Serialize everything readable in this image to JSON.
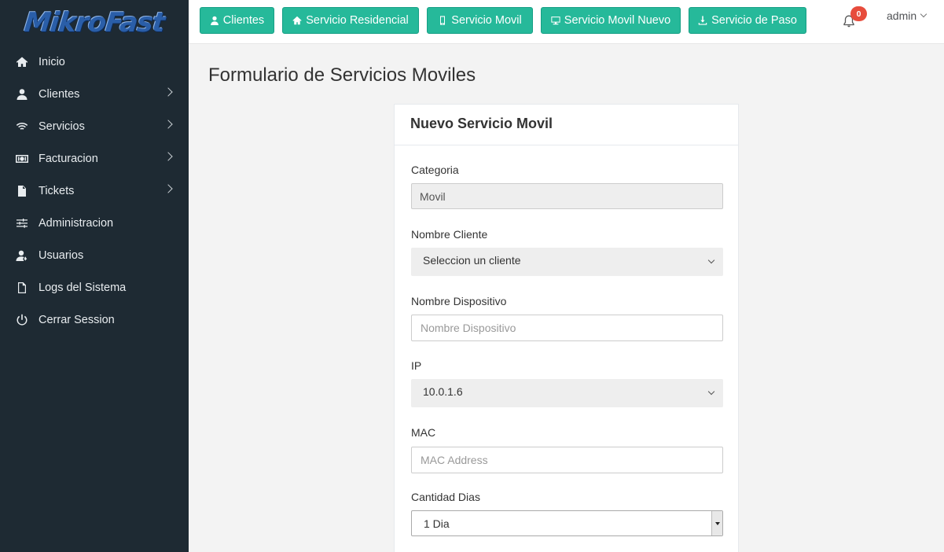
{
  "brand": {
    "logo_text": "MikroFast"
  },
  "sidebar": {
    "items": [
      {
        "label": "Inicio",
        "icon": "home-icon",
        "has_submenu": false
      },
      {
        "label": "Clientes",
        "icon": "user-icon",
        "has_submenu": true
      },
      {
        "label": "Servicios",
        "icon": "wifi-icon",
        "has_submenu": true
      },
      {
        "label": "Facturacion",
        "icon": "money-icon",
        "has_submenu": true
      },
      {
        "label": "Tickets",
        "icon": "file-icon",
        "has_submenu": true
      },
      {
        "label": "Administracion",
        "icon": "sliders-icon",
        "has_submenu": false
      },
      {
        "label": "Usuarios",
        "icon": "users-icon",
        "has_submenu": false
      },
      {
        "label": "Logs del Sistema",
        "icon": "file-outline-icon",
        "has_submenu": false
      },
      {
        "label": "Cerrar Session",
        "icon": "power-icon",
        "has_submenu": false
      }
    ]
  },
  "topbar": {
    "buttons": [
      {
        "label": "Clientes",
        "icon": "user-icon"
      },
      {
        "label": "Servicio Residencial",
        "icon": "home-icon"
      },
      {
        "label": "Servicio Movil",
        "icon": "mobile-icon"
      },
      {
        "label": "Servicio Movil Nuevo",
        "icon": "desktop-icon"
      },
      {
        "label": "Servicio de Paso",
        "icon": "download-icon"
      }
    ],
    "notifications_count": "0",
    "user": "admin"
  },
  "page": {
    "title": "Formulario de Servicios Moviles"
  },
  "form": {
    "title": "Nuevo Servicio Movil",
    "categoria": {
      "label": "Categoria",
      "value": "Movil"
    },
    "cliente": {
      "label": "Nombre Cliente",
      "value": "Seleccion un cliente"
    },
    "dispositivo": {
      "label": "Nombre Dispositivo",
      "placeholder": "Nombre Dispositivo",
      "value": ""
    },
    "ip": {
      "label": "IP",
      "value": "10.0.1.6"
    },
    "mac": {
      "label": "MAC",
      "placeholder": "MAC Address",
      "value": ""
    },
    "dias": {
      "label": "Cantidad Dias",
      "value": "1 Dia"
    }
  },
  "colors": {
    "accent": "#26b99a",
    "sidebar": "#1e2a33",
    "badge": "#e74c3c"
  }
}
